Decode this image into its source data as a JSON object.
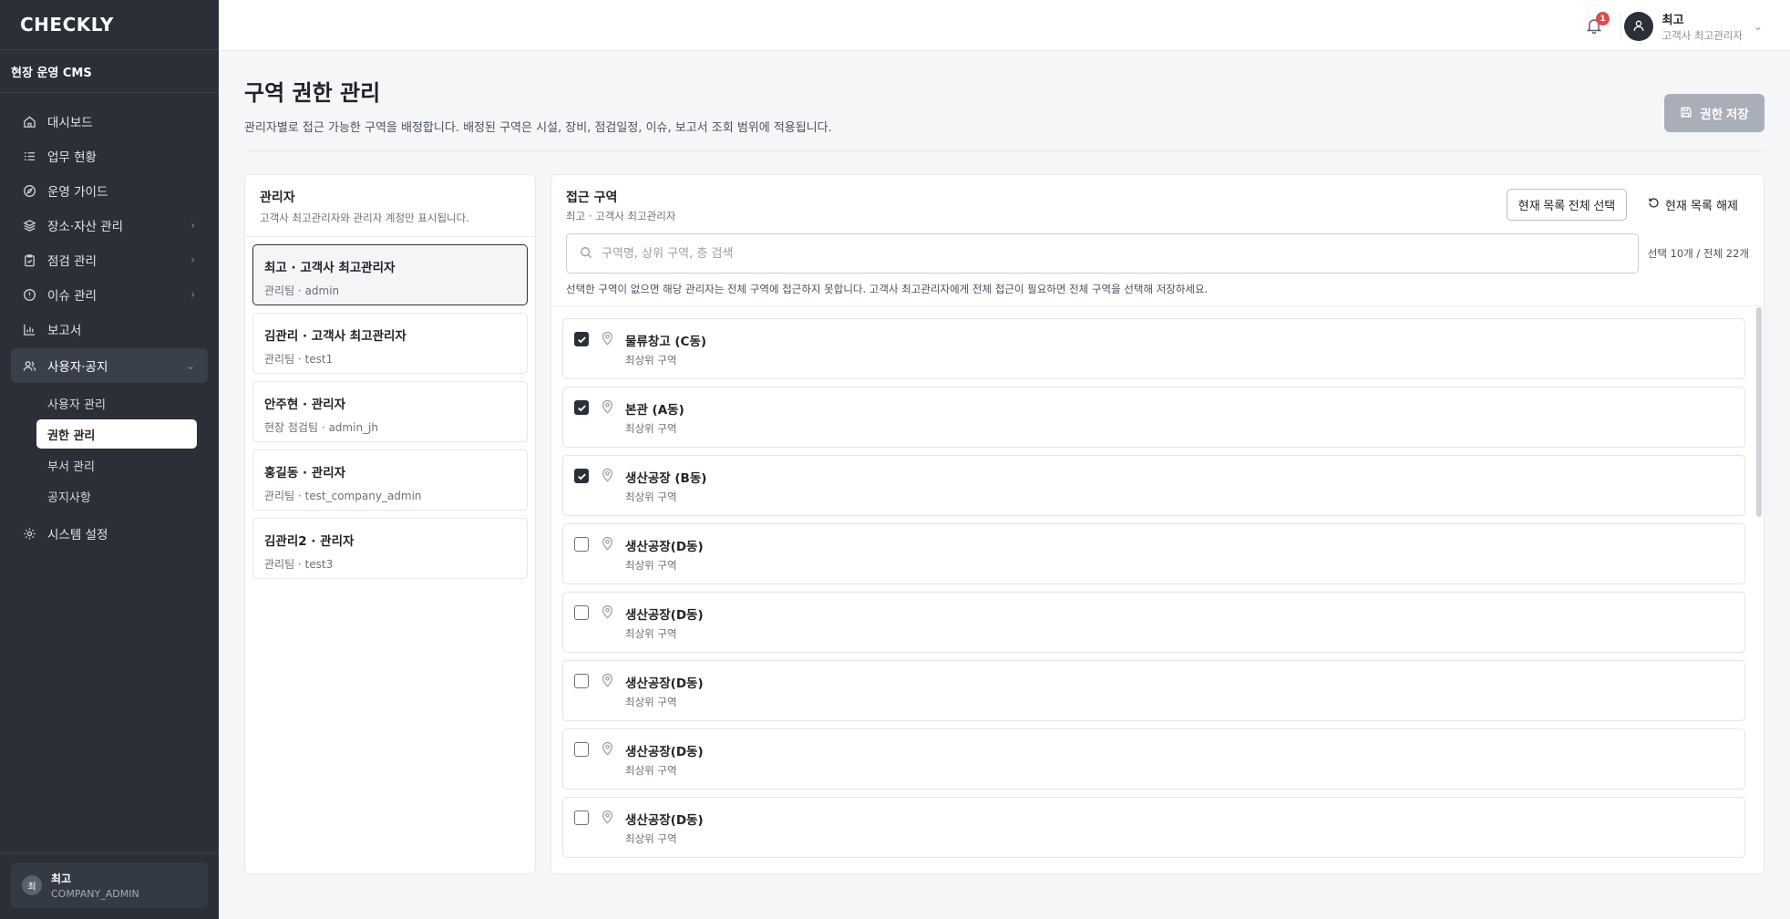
{
  "sidebar": {
    "logo": "CHECKLY",
    "cms_title": "현장 운영 CMS",
    "nav": [
      {
        "label": "대시보드"
      },
      {
        "label": "업무 현황"
      },
      {
        "label": "운영 가이드"
      },
      {
        "label": "장소·자산 관리"
      },
      {
        "label": "점검 관리"
      },
      {
        "label": "이슈 관리"
      },
      {
        "label": "보고서"
      },
      {
        "label": "사용자·공지"
      },
      {
        "label": "시스템 설정"
      }
    ],
    "subnav": [
      {
        "label": "사용자 관리"
      },
      {
        "label": "권한 관리"
      },
      {
        "label": "부서 관리"
      },
      {
        "label": "공지사항"
      }
    ],
    "footer": {
      "avatar": "최",
      "name": "최고",
      "role": "COMPANY_ADMIN"
    }
  },
  "topbar": {
    "notification_count": "1",
    "user_name": "최고",
    "user_role": "고객사 최고관리자"
  },
  "page": {
    "title": "구역 권한 관리",
    "description": "관리자별로 접근 가능한 구역을 배정합니다. 배정된 구역은 시설, 장비, 점검일정, 이슈, 보고서 조회 범위에 적용됩니다.",
    "save_label": "권한 저장"
  },
  "admins": {
    "title": "관리자",
    "subtitle": "고객사 최고관리자와 관리자 계정만 표시됩니다.",
    "items": [
      {
        "name": "최고 · 고객사 최고관리자",
        "meta": "관리팀 · admin"
      },
      {
        "name": "김관리 · 고객사 최고관리자",
        "meta": "관리팀 · test1"
      },
      {
        "name": "안주현 · 관리자",
        "meta": "현장 점검팀 · admin_jh"
      },
      {
        "name": "홍길동 · 관리자",
        "meta": "관리팀 · test_company_admin"
      },
      {
        "name": "김관리2 · 관리자",
        "meta": "관리팀 · test3"
      }
    ]
  },
  "zones": {
    "title": "접근 구역",
    "subtitle": "최고 · 고객사 최고관리자",
    "select_all_label": "현재 목록 전체 선택",
    "clear_label": "현재 목록 해제",
    "search_placeholder": "구역명, 상위 구역, 층 검색",
    "count_text": "선택 10개 / 전체 22개",
    "notice": "선택한 구역이 없으면 해당 관리자는 전체 구역에 접근하지 못합니다. 고객사 최고관리자에게 전체 접근이 필요하면 전체 구역을 선택해 저장하세요.",
    "items": [
      {
        "name": "물류창고 (C동)",
        "level": "최상위 구역",
        "checked": true
      },
      {
        "name": "본관 (A동)",
        "level": "최상위 구역",
        "checked": true
      },
      {
        "name": "생산공장 (B동)",
        "level": "최상위 구역",
        "checked": true
      },
      {
        "name": "생산공장(D동)",
        "level": "최상위 구역",
        "checked": false
      },
      {
        "name": "생산공장(D동)",
        "level": "최상위 구역",
        "checked": false
      },
      {
        "name": "생산공장(D동)",
        "level": "최상위 구역",
        "checked": false
      },
      {
        "name": "생산공장(D동)",
        "level": "최상위 구역",
        "checked": false
      },
      {
        "name": "생산공장(D동)",
        "level": "최상위 구역",
        "checked": false
      }
    ]
  }
}
